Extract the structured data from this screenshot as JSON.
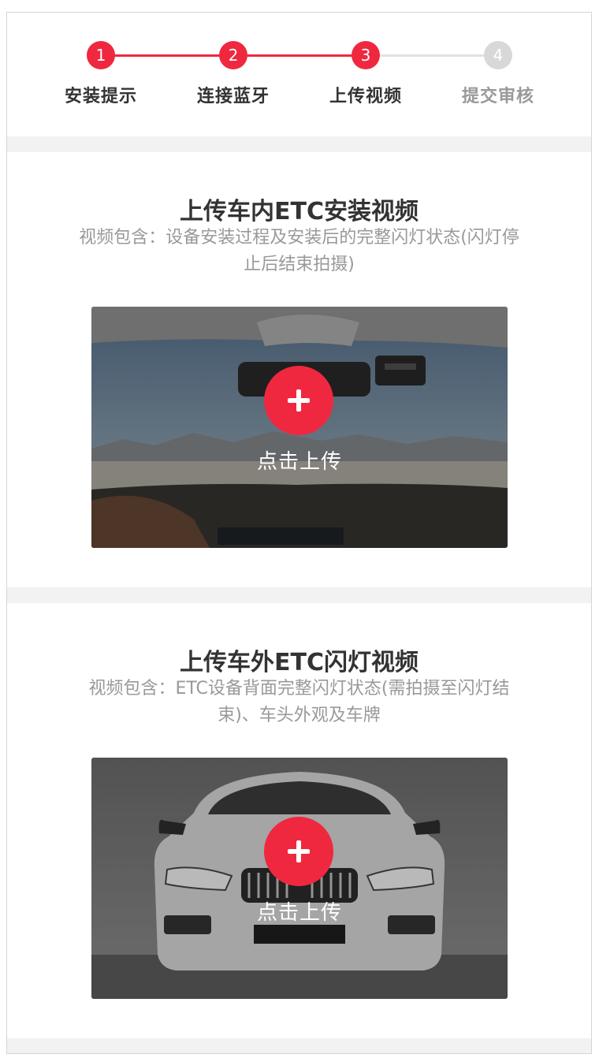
{
  "steps": [
    {
      "number": "1",
      "label": "安装提示",
      "state": "done"
    },
    {
      "number": "2",
      "label": "连接蓝牙",
      "state": "done"
    },
    {
      "number": "3",
      "label": "上传视频",
      "state": "active"
    },
    {
      "number": "4",
      "label": "提交审核",
      "state": "pending"
    }
  ],
  "colors": {
    "accent": "#f0283f",
    "inactive": "#d8d8d8"
  },
  "sections": [
    {
      "title": "上传车内ETC安装视频",
      "desc_line1": "视频包含：设备安装过程及安装后的完整闪灯状态(闪灯停",
      "desc_line2": "止后结束拍摄)",
      "image": "car-interior-windshield-photo",
      "upload_label": "点击上传"
    },
    {
      "title": "上传车外ETC闪灯视频",
      "desc_line1": "视频包含：ETC设备背面完整闪灯状态(需拍摄至闪灯结",
      "desc_line2": "束)、车头外观及车牌",
      "image": "car-front-exterior-photo",
      "upload_label": "点击上传"
    }
  ]
}
